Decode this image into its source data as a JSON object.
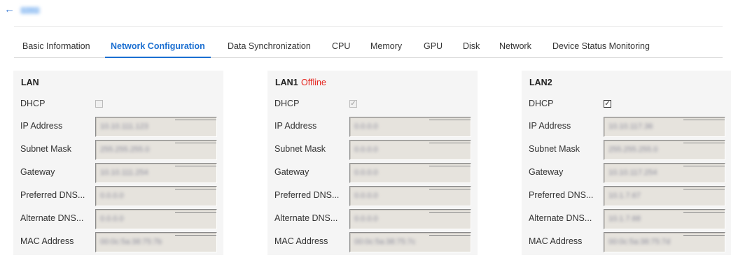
{
  "header": {
    "back_icon": "←",
    "device_name": "1281"
  },
  "tabs": [
    {
      "label": "Basic Information"
    },
    {
      "label": "Network Configuration"
    },
    {
      "label": "Data Synchronization"
    },
    {
      "label": "CPU"
    },
    {
      "label": "Memory"
    },
    {
      "label": "GPU"
    },
    {
      "label": "Disk"
    },
    {
      "label": "Network"
    },
    {
      "label": "Device Status Monitoring"
    }
  ],
  "active_tab": "Network Configuration",
  "labels": {
    "dhcp": "DHCP",
    "ip": "IP Address",
    "subnet": "Subnet Mask",
    "gateway": "Gateway",
    "pdns": "Preferred DNS...",
    "adns": "Alternate DNS...",
    "mac": "MAC Address"
  },
  "panels": [
    {
      "title": "LAN",
      "status": "",
      "dhcp_checked": false,
      "dhcp_enabled": false,
      "ip": "10.10.111.123",
      "subnet": "255.255.255.0",
      "gateway": "10.10.111.254",
      "pdns": "0.0.0.0",
      "adns": "0.0.0.0",
      "mac": "00:0c:5a:38:75:7b"
    },
    {
      "title": "LAN1",
      "status": "Offline",
      "dhcp_checked": true,
      "dhcp_enabled": false,
      "ip": "0.0.0.0",
      "subnet": "0.0.0.0",
      "gateway": "0.0.0.0",
      "pdns": "0.0.0.0",
      "adns": "0.0.0.0",
      "mac": "00:0c:5a:38:75:7c"
    },
    {
      "title": "LAN2",
      "status": "",
      "dhcp_checked": true,
      "dhcp_enabled": true,
      "ip": "10.10.117.36",
      "subnet": "255.255.255.0",
      "gateway": "10.10.117.254",
      "pdns": "10.1.7.67",
      "adns": "10.1.7.68",
      "mac": "00:0c:5a:38:75:7d"
    }
  ],
  "colors": {
    "accent": "#1b6fd1",
    "offline": "#e5261f",
    "panel_bg": "#f5f5f5"
  }
}
